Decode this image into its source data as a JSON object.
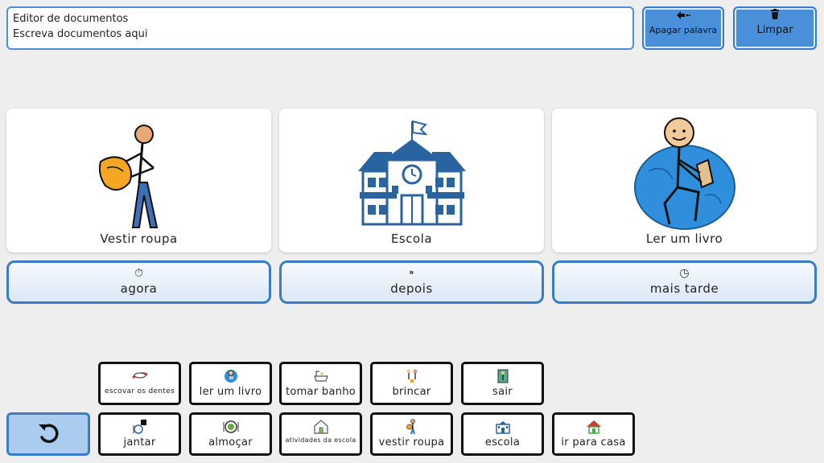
{
  "editor": {
    "line1": "Editor de documentos",
    "line2": "Escreva documentos aqui"
  },
  "toolbar": {
    "delete_word_label": "Apagar palavra",
    "clear_label": "Limpar",
    "accent": "#4a90d9"
  },
  "schedule_cards": [
    {
      "label": "Vestir roupa",
      "icon": "person-dressing-icon"
    },
    {
      "label": "Escola",
      "icon": "school-building-icon"
    },
    {
      "label": "Ler um livro",
      "icon": "person-reading-icon"
    }
  ],
  "time_buttons": [
    {
      "label": "agora",
      "icon": "stopwatch-icon"
    },
    {
      "label": "depois",
      "icon": "next-arrow-icon"
    },
    {
      "label": "mais tarde",
      "icon": "clock-icon"
    }
  ],
  "tiles_row1": [
    {
      "label": "escovar os dentes",
      "icon": "toothbrush-icon"
    },
    {
      "label": "ler um livro",
      "icon": "reading-icon"
    },
    {
      "label": "tomar banho",
      "icon": "bathtub-icon"
    },
    {
      "label": "brincar",
      "icon": "children-playing-icon"
    },
    {
      "label": "sair",
      "icon": "door-exit-icon"
    }
  ],
  "tiles_row2": [
    {
      "label": "jantar",
      "icon": "dinner-icon"
    },
    {
      "label": "almoçar",
      "icon": "lunch-icon"
    },
    {
      "label": "atividades da escola",
      "icon": "school-activities-icon"
    },
    {
      "label": "vestir roupa",
      "icon": "dressing-icon"
    },
    {
      "label": "escola",
      "icon": "school-icon"
    },
    {
      "label": "ir para casa",
      "icon": "house-icon"
    }
  ],
  "colors": {
    "background": "#eeeeee",
    "button_blue": "#4a90d9",
    "border_blue": "#3c7cc6",
    "tile_border": "#111111"
  }
}
